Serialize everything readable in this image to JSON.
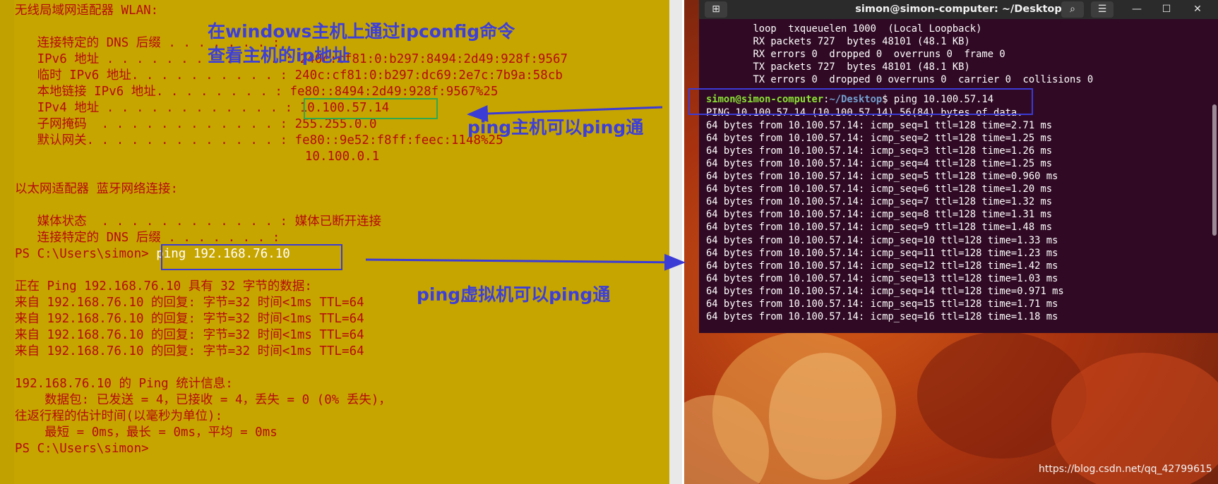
{
  "powershell": {
    "lines": [
      "无线局域网适配器 WLAN:",
      "",
      "   连接特定的 DNS 后缀 . . . . . . . :",
      "   IPv6 地址 . . . . . . . . . . . . : 240c:cf81:0:b297:8494:2d49:928f:9567",
      "   临时 IPv6 地址. . . . . . . . . . : 240c:cf81:0:b297:dc69:2e7c:7b9a:58cb",
      "   本地链接 IPv6 地址. . . . . . . . : fe80::8494:2d49:928f:9567%25",
      "   IPv4 地址 . . . . . . . . . . . . : 10.100.57.14",
      "   子网掩码  . . . . . . . . . . . . : 255.255.0.0",
      "   默认网关. . . . . . . . . . . . . : fe80::9e52:f8ff:feec:1148%25",
      "                                       10.100.0.1",
      "",
      "以太网适配器 蓝牙网络连接:",
      "",
      "   媒体状态  . . . . . . . . . . . . : 媒体已断开连接",
      "   连接特定的 DNS 后缀 . . . . . . . :"
    ],
    "prompt": "PS C:\\Users\\simon>",
    "command": "ping 192.168.76.10",
    "ping_lines": [
      "",
      "正在 Ping 192.168.76.10 具有 32 字节的数据:",
      "来自 192.168.76.10 的回复: 字节=32 时间<1ms TTL=64",
      "来自 192.168.76.10 的回复: 字节=32 时间<1ms TTL=64",
      "来自 192.168.76.10 的回复: 字节=32 时间<1ms TTL=64",
      "来自 192.168.76.10 的回复: 字节=32 时间<1ms TTL=64",
      "",
      "192.168.76.10 的 Ping 统计信息:",
      "    数据包: 已发送 = 4，已接收 = 4，丢失 = 0 (0% 丢失)，",
      "往返行程的估计时间(以毫秒为单位):",
      "    最短 = 0ms，最长 = 0ms，平均 = 0ms"
    ],
    "final_prompt": "PS C:\\Users\\simon>"
  },
  "annotations": {
    "ipconfig_note_line1": "在windows主机上通过ipconfig命令",
    "ipconfig_note_line2": "查看主机的ip地址",
    "ping_host_note": "ping主机可以ping通",
    "ping_vm_note": "ping虚拟机可以ping通",
    "annotation_color": "#3d3fd8"
  },
  "terminal": {
    "title": "simon@simon-computer: ~/Desktop",
    "new_tab_icon": "new-tab-icon",
    "buttons": [
      "search-icon",
      "hamburger-menu-icon",
      "minimize-icon",
      "maximize-icon",
      "close-icon"
    ],
    "top_lines": [
      "        loop  txqueuelen 1000  (Local Loopback)",
      "        RX packets 727  bytes 48101 (48.1 KB)",
      "        RX errors 0  dropped 0  overruns 0  frame 0",
      "        TX packets 727  bytes 48101 (48.1 KB)",
      "        TX errors 0  dropped 0 overruns 0  carrier 0  collisions 0"
    ],
    "prompt_user": "simon@simon-computer",
    "prompt_sep": ":",
    "prompt_path": "~/Desktop",
    "prompt_end": "$ ",
    "command": "ping 10.100.57.14",
    "header": "PING 10.100.57.14 (10.100.57.14) 56(84) bytes of data.",
    "replies": [
      "64 bytes from 10.100.57.14: icmp_seq=1 ttl=128 time=2.71 ms",
      "64 bytes from 10.100.57.14: icmp_seq=2 ttl=128 time=1.25 ms",
      "64 bytes from 10.100.57.14: icmp_seq=3 ttl=128 time=1.26 ms",
      "64 bytes from 10.100.57.14: icmp_seq=4 ttl=128 time=1.25 ms",
      "64 bytes from 10.100.57.14: icmp_seq=5 ttl=128 time=0.960 ms",
      "64 bytes from 10.100.57.14: icmp_seq=6 ttl=128 time=1.20 ms",
      "64 bytes from 10.100.57.14: icmp_seq=7 ttl=128 time=1.32 ms",
      "64 bytes from 10.100.57.14: icmp_seq=8 ttl=128 time=1.31 ms",
      "64 bytes from 10.100.57.14: icmp_seq=9 ttl=128 time=1.48 ms",
      "64 bytes from 10.100.57.14: icmp_seq=10 ttl=128 time=1.33 ms",
      "64 bytes from 10.100.57.14: icmp_seq=11 ttl=128 time=1.23 ms",
      "64 bytes from 10.100.57.14: icmp_seq=12 ttl=128 time=1.42 ms",
      "64 bytes from 10.100.57.14: icmp_seq=13 ttl=128 time=1.03 ms",
      "64 bytes from 10.100.57.14: icmp_seq=14 ttl=128 time=0.971 ms",
      "64 bytes from 10.100.57.14: icmp_seq=15 ttl=128 time=1.71 ms",
      "64 bytes from 10.100.57.14: icmp_seq=16 ttl=128 time=1.18 ms"
    ]
  },
  "watermark": "https://blog.csdn.net/qq_42799615"
}
